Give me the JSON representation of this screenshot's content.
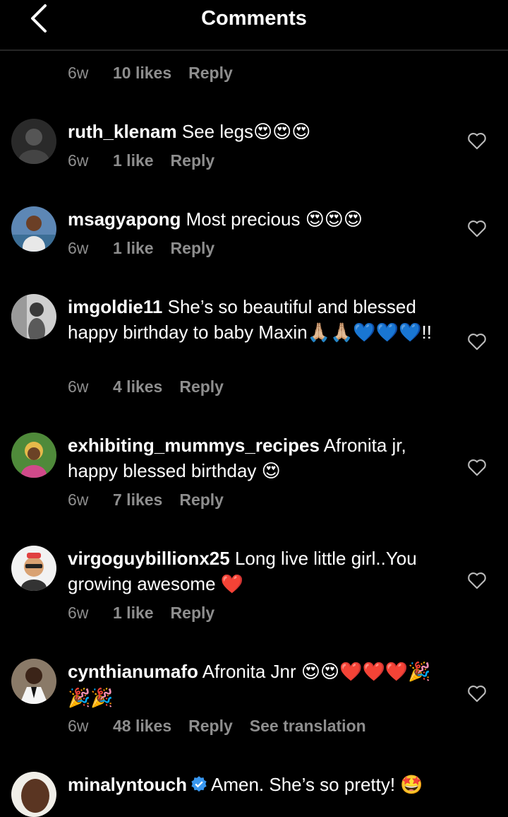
{
  "header": {
    "title": "Comments"
  },
  "partial": {
    "time": "6w",
    "likes": "10 likes",
    "reply": "Reply"
  },
  "comments": [
    {
      "user": "ruth_klenam",
      "text": "See legs",
      "emoji": "😍😍😍",
      "time": "6w",
      "likes": "1 like",
      "reply": "Reply"
    },
    {
      "user": "msagyapong",
      "text": "Most precious ",
      "emoji": "😍😍😍",
      "time": "6w",
      "likes": "1 like",
      "reply": "Reply"
    },
    {
      "user": "imgoldie11",
      "text": "She’s so beautiful and blessed happy birthday to baby Maxin",
      "emoji": "🙏🏼🙏🏼💙💙💙",
      "suffix": "!!",
      "time": "6w",
      "likes": "4 likes",
      "reply": "Reply"
    },
    {
      "user": "exhibiting_mummys_recipes",
      "text": "Afronita jr, happy blessed birthday ",
      "emoji": "😍",
      "time": "6w",
      "likes": "7 likes",
      "reply": "Reply"
    },
    {
      "user": "virgoguybillionx25",
      "text": "Long live little girl..You growing awesome ",
      "emoji": "❤️",
      "time": "6w",
      "likes": "1 like",
      "reply": "Reply"
    },
    {
      "user": "cynthianumafo",
      "text": "Afronita Jnr ",
      "emoji": "😍😍❤️❤️❤️🎉🎉🎉",
      "time": "6w",
      "likes": "48 likes",
      "reply": "Reply",
      "translate": "See translation"
    },
    {
      "user": "minalyntouch",
      "text": "Amen. She’s so pretty! ",
      "emoji": "🤩",
      "verified": true
    }
  ],
  "colors": {
    "background": "#000000",
    "secondary_text": "#8e8e8e",
    "verified": "#3897f0"
  },
  "icons": [
    "back-arrow-icon",
    "heart-outline-icon",
    "verified-badge-icon"
  ]
}
